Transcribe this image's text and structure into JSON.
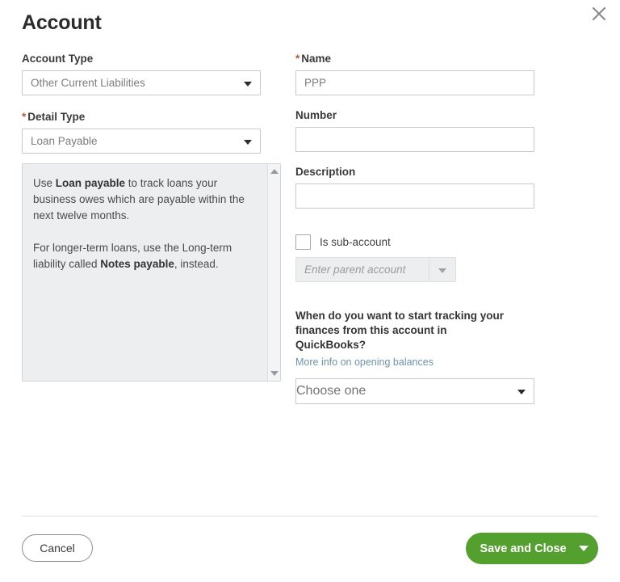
{
  "header": {
    "title": "Account",
    "close_icon": "close-icon"
  },
  "left_column": {
    "account_type": {
      "label": "Account Type",
      "required": false,
      "value": "Other Current Liabilities"
    },
    "detail_type": {
      "label": "Detail Type",
      "required": true,
      "required_marker": "*",
      "value": "Loan Payable"
    },
    "help_panel": {
      "paragraph_1_pre": "Use ",
      "paragraph_1_bold": "Loan payable",
      "paragraph_1_post": " to track loans your business owes which are payable within the next twelve months.",
      "paragraph_2_pre": "For longer-term loans, use the Long-term liability called ",
      "paragraph_2_bold": "Notes payable",
      "paragraph_2_post": ", instead.",
      "scroll_up_icon": "scroll-up-arrow-icon",
      "scroll_down_icon": "scroll-down-arrow-icon"
    }
  },
  "right_column": {
    "name": {
      "label": "Name",
      "required_marker": "*",
      "value": "PPP"
    },
    "number": {
      "label": "Number",
      "value": "",
      "placeholder": ""
    },
    "description": {
      "label": "Description",
      "value": "",
      "placeholder": ""
    },
    "sub_account": {
      "checkbox_label": "Is sub-account",
      "checked": false,
      "parent_placeholder": "Enter parent account",
      "disabled": true
    },
    "tracking": {
      "question": "When do you want to start tracking your finances from this account in QuickBooks?",
      "link_text": "More info on opening balances",
      "select_value": "Choose one"
    }
  },
  "footer": {
    "cancel_label": "Cancel",
    "save_label": "Save and Close",
    "save_chevron_icon": "chevron-down-icon"
  },
  "colors": {
    "accent_green": "#53a02f",
    "required_red": "#b5573f",
    "link_blue": "#6e93ad",
    "panel_gray": "#eceef0"
  }
}
